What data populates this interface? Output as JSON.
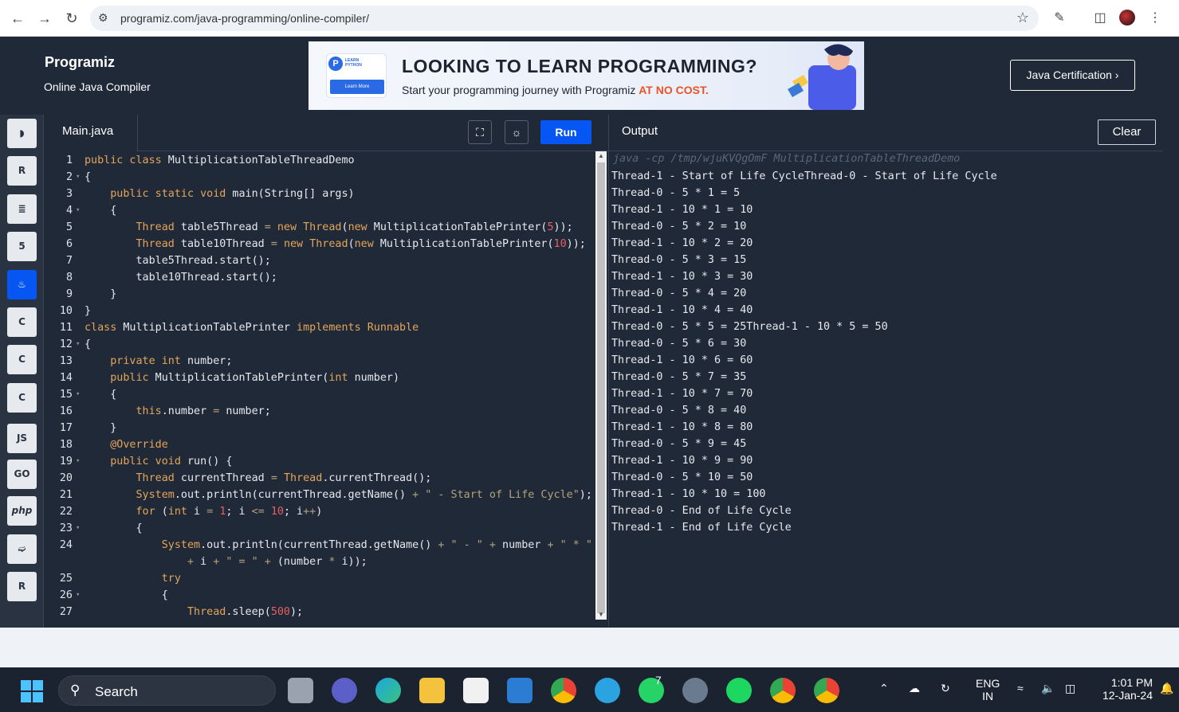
{
  "browser": {
    "url": "programiz.com/java-programming/online-compiler/"
  },
  "header": {
    "logo": "Programiz",
    "subtitle": "Online Java Compiler",
    "banner": {
      "badge_title": "LEARN PYTHON",
      "badge_button": "Learn More",
      "headline": "LOOKING TO LEARN PROGRAMMING?",
      "sub_text": "Start your programming journey with Programiz ",
      "sub_highlight": "AT NO COST."
    },
    "cert_button": "Java Certification ›"
  },
  "sidebar": {
    "items": [
      {
        "name": "python",
        "glyph": "◗"
      },
      {
        "name": "r",
        "glyph": "R"
      },
      {
        "name": "sql",
        "glyph": "≣"
      },
      {
        "name": "html",
        "glyph": "5"
      },
      {
        "name": "java",
        "glyph": "♨",
        "active": true
      },
      {
        "name": "c",
        "glyph": "C"
      },
      {
        "name": "cpp",
        "glyph": "C"
      },
      {
        "name": "csharp",
        "glyph": "C"
      },
      {
        "name": "javascript",
        "glyph": "JS"
      },
      {
        "name": "go",
        "glyph": "GO"
      },
      {
        "name": "php",
        "glyph": "php"
      },
      {
        "name": "swift",
        "glyph": "➫"
      },
      {
        "name": "rust",
        "glyph": "R"
      }
    ]
  },
  "editor": {
    "file_name": "Main.java",
    "run_label": "Run",
    "lines": [
      {
        "n": "1",
        "fold": "",
        "html": "<span class='kw'>public class</span> MultiplicationTableThreadDemo"
      },
      {
        "n": "2",
        "fold": "▾",
        "html": "{"
      },
      {
        "n": "3",
        "fold": "",
        "html": "    <span class='kw'>public static void</span> main(String[] args)"
      },
      {
        "n": "4",
        "fold": "▾",
        "html": "    {"
      },
      {
        "n": "5",
        "fold": "",
        "html": "        <span class='kw'>Thread</span> table5Thread <span class='op'>=</span> <span class='kw'>new</span> <span class='kw'>Thread</span>(<span class='kw'>new</span> MultiplicationTablePrinter(<span class='num'>5</span>));"
      },
      {
        "n": "6",
        "fold": "",
        "html": "        <span class='kw'>Thread</span> table10Thread <span class='op'>=</span> <span class='kw'>new</span> <span class='kw'>Thread</span>(<span class='kw'>new</span> MultiplicationTablePrinter(<span class='num'>10</span>));"
      },
      {
        "n": "7",
        "fold": "",
        "html": "        table5Thread.start();"
      },
      {
        "n": "8",
        "fold": "",
        "html": "        table10Thread.start();"
      },
      {
        "n": "9",
        "fold": "",
        "html": "    }"
      },
      {
        "n": "10",
        "fold": "",
        "html": "}"
      },
      {
        "n": "11",
        "fold": "",
        "html": "<span class='kw'>class</span> MultiplicationTablePrinter <span class='kw'>implements</span> <span class='kw'>Runnable</span>"
      },
      {
        "n": "12",
        "fold": "▾",
        "html": "{"
      },
      {
        "n": "13",
        "fold": "",
        "html": "    <span class='kw'>private int</span> number;"
      },
      {
        "n": "14",
        "fold": "",
        "html": "    <span class='kw'>public</span> MultiplicationTablePrinter(<span class='kw'>int</span> number)"
      },
      {
        "n": "15",
        "fold": "▾",
        "html": "    {"
      },
      {
        "n": "16",
        "fold": "",
        "html": "        <span class='kw'>this</span>.number <span class='op'>=</span> number;"
      },
      {
        "n": "17",
        "fold": "",
        "html": "    }"
      },
      {
        "n": "18",
        "fold": "",
        "html": "    <span class='kw'>@Override</span>"
      },
      {
        "n": "19",
        "fold": "▾",
        "html": "    <span class='kw'>public void</span> run() {"
      },
      {
        "n": "20",
        "fold": "",
        "html": "        <span class='kw'>Thread</span> currentThread <span class='op'>=</span> <span class='kw'>Thread</span>.currentThread();"
      },
      {
        "n": "21",
        "fold": "",
        "html": "        <span class='kw'>System</span>.out.println(currentThread.getName() <span class='op'>+</span> <span class='str'>\" - Start of Life Cycle\"</span>);"
      },
      {
        "n": "22",
        "fold": "",
        "html": "        <span class='kw'>for</span> (<span class='kw'>int</span> i <span class='op'>=</span> <span class='num'>1</span>; i <span class='op'>&lt;=</span> <span class='num'>10</span>; i<span class='op'>++</span>)"
      },
      {
        "n": "23",
        "fold": "▾",
        "html": "        {"
      },
      {
        "n": "24",
        "fold": "",
        "html": "            <span class='kw'>System</span>.out.println(currentThread.getName() <span class='op'>+</span> <span class='str'>\" - \"</span> <span class='op'>+</span> number <span class='op'>+</span> <span class='str'>\" * \"</span>"
      },
      {
        "n": "",
        "fold": "",
        "html": "                <span class='op'>+</span> i <span class='op'>+</span> <span class='str'>\" = \"</span> <span class='op'>+</span> (number <span class='op'>*</span> i));"
      },
      {
        "n": "25",
        "fold": "",
        "html": "            <span class='kw'>try</span>"
      },
      {
        "n": "26",
        "fold": "▾",
        "html": "            {"
      },
      {
        "n": "27",
        "fold": "",
        "html": "                <span class='kw'>Thread</span>.sleep(<span class='num'>500</span>);"
      }
    ]
  },
  "output": {
    "title": "Output",
    "clear_label": "Clear",
    "command": "java -cp /tmp/wjuKVQgOmF MultiplicationTableThreadDemo",
    "lines": [
      "Thread-1 - Start of Life CycleThread-0 - Start of Life Cycle",
      "Thread-0 - 5 * 1 = 5",
      "Thread-1 - 10 * 1 = 10",
      "Thread-0 - 5 * 2 = 10",
      "Thread-1 - 10 * 2 = 20",
      "Thread-0 - 5 * 3 = 15",
      "Thread-1 - 10 * 3 = 30",
      "Thread-0 - 5 * 4 = 20",
      "Thread-1 - 10 * 4 = 40",
      "Thread-0 - 5 * 5 = 25Thread-1 - 10 * 5 = 50",
      "Thread-0 - 5 * 6 = 30",
      "Thread-1 - 10 * 6 = 60",
      "Thread-0 - 5 * 7 = 35",
      "Thread-1 - 10 * 7 = 70",
      "Thread-0 - 5 * 8 = 40",
      "Thread-1 - 10 * 8 = 80",
      "Thread-0 - 5 * 9 = 45",
      "Thread-1 - 10 * 9 = 90",
      "Thread-0 - 5 * 10 = 50",
      "Thread-1 - 10 * 10 = 100",
      "Thread-0 - End of Life Cycle",
      "Thread-1 - End of Life Cycle"
    ]
  },
  "taskbar": {
    "search": "Search",
    "language": "ENG",
    "region": "IN",
    "time": "1:01 PM",
    "date": "12-Jan-24",
    "whatsapp_badge": "7",
    "colors": {
      "start": "#4cc2ff",
      "chrome_red": "#ea4335",
      "chrome_yellow": "#fbbc05",
      "chrome_green": "#34a853",
      "spotify": "#1ed760",
      "telegram": "#2aa3e0",
      "whatsapp": "#25d366"
    }
  }
}
